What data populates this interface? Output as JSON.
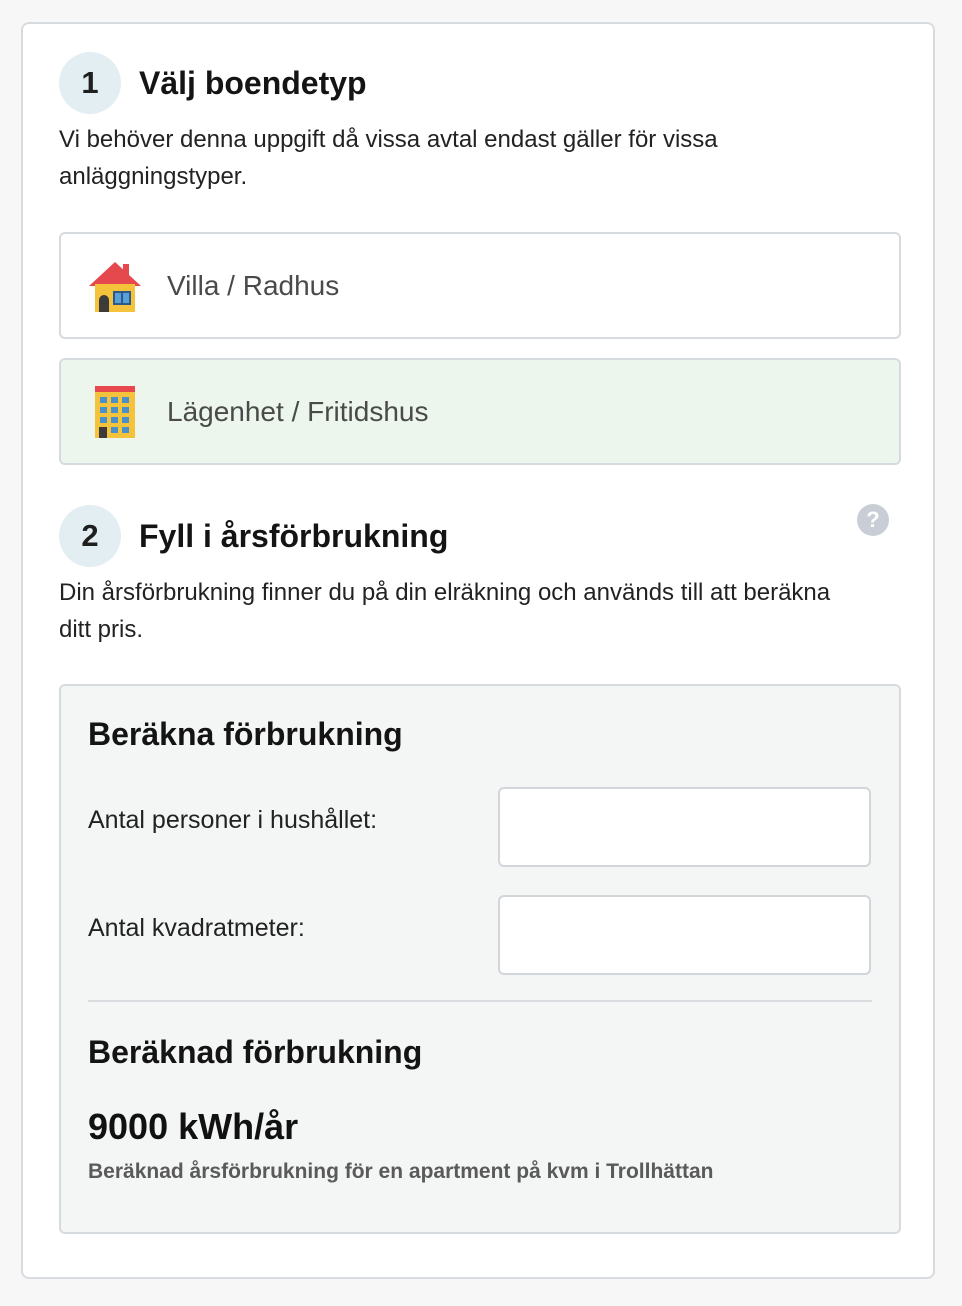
{
  "step1": {
    "number": "1",
    "title": "Välj boendetyp",
    "description": "Vi behöver denna uppgift då vissa avtal endast gäller för vissa anläggningstyper.",
    "options": [
      {
        "label": "Villa / Radhus",
        "icon": "house-icon",
        "selected": false
      },
      {
        "label": "Lägenhet / Fritidshus",
        "icon": "apartment-building-icon",
        "selected": true
      }
    ]
  },
  "step2": {
    "number": "2",
    "title": "Fyll i årsförbrukning",
    "description": "Din årsförbrukning finner du på din elräkning och används till att beräkna ditt pris.",
    "help_icon": "?"
  },
  "calculator": {
    "title": "Beräkna förbrukning",
    "persons_label": "Antal personer i hushållet:",
    "persons_value": "",
    "area_label": "Antal kvadratmeter:",
    "area_value": "",
    "result_title": "Beräknad förbrukning",
    "result_value": "9000 kWh/år",
    "result_note": "Beräknad årsförbrukning för en apartment på kvm i Trollhättan"
  },
  "colors": {
    "selected_bg": "#ecf6ec",
    "step_badge_bg": "#e3eef2",
    "border": "#d7dbe0"
  }
}
